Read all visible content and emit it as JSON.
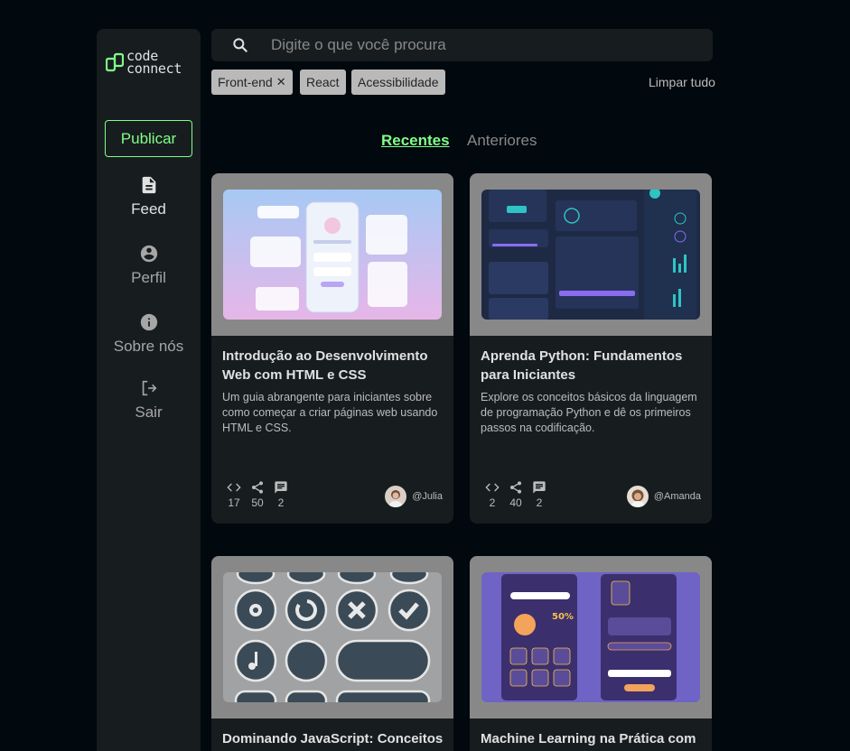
{
  "brand": {
    "line1": "code",
    "line2": "connect"
  },
  "sidebar": {
    "publish_label": "Publicar",
    "items": [
      {
        "label": "Feed",
        "icon": "document-icon",
        "active": true
      },
      {
        "label": "Perfil",
        "icon": "account-circle-icon",
        "active": false
      },
      {
        "label": "Sobre nós",
        "icon": "info-icon",
        "active": false
      },
      {
        "label": "Sair",
        "icon": "logout-icon",
        "active": false
      }
    ]
  },
  "search": {
    "placeholder": "Digite o que você procura",
    "value": ""
  },
  "filters": {
    "tags": [
      {
        "label": "Front-end",
        "removable": true
      },
      {
        "label": "React",
        "removable": false
      },
      {
        "label": "Acessibilidade",
        "removable": false
      }
    ],
    "clear_label": "Limpar tudo"
  },
  "tabs": [
    {
      "label": "Recentes",
      "active": true
    },
    {
      "label": "Anteriores",
      "active": false
    }
  ],
  "cards": [
    {
      "title": "Introdução ao Desenvolvimento Web com HTML e CSS",
      "description": "Um guia abrangente para iniciantes sobre como começar a criar páginas web usando HTML e CSS.",
      "code": "17",
      "shares": "50",
      "comments": "2",
      "author": "@Julia"
    },
    {
      "title": "Aprenda Python: Fundamentos para Iniciantes",
      "description": "Explore os conceitos básicos da linguagem de programação Python e dê os primeiros passos na codificação.",
      "code": "2",
      "shares": "40",
      "comments": "2",
      "author": "@Amanda"
    },
    {
      "title": "Dominando JavaScript: Conceitos",
      "description": "",
      "code": "",
      "shares": "",
      "comments": "",
      "author": ""
    },
    {
      "title": "Machine Learning na Prática com",
      "description": "",
      "code": "",
      "shares": "",
      "comments": "",
      "author": ""
    }
  ],
  "colors": {
    "accent": "#81fe88",
    "background": "#01080e",
    "surface": "#171d1f",
    "media": "#888888"
  }
}
